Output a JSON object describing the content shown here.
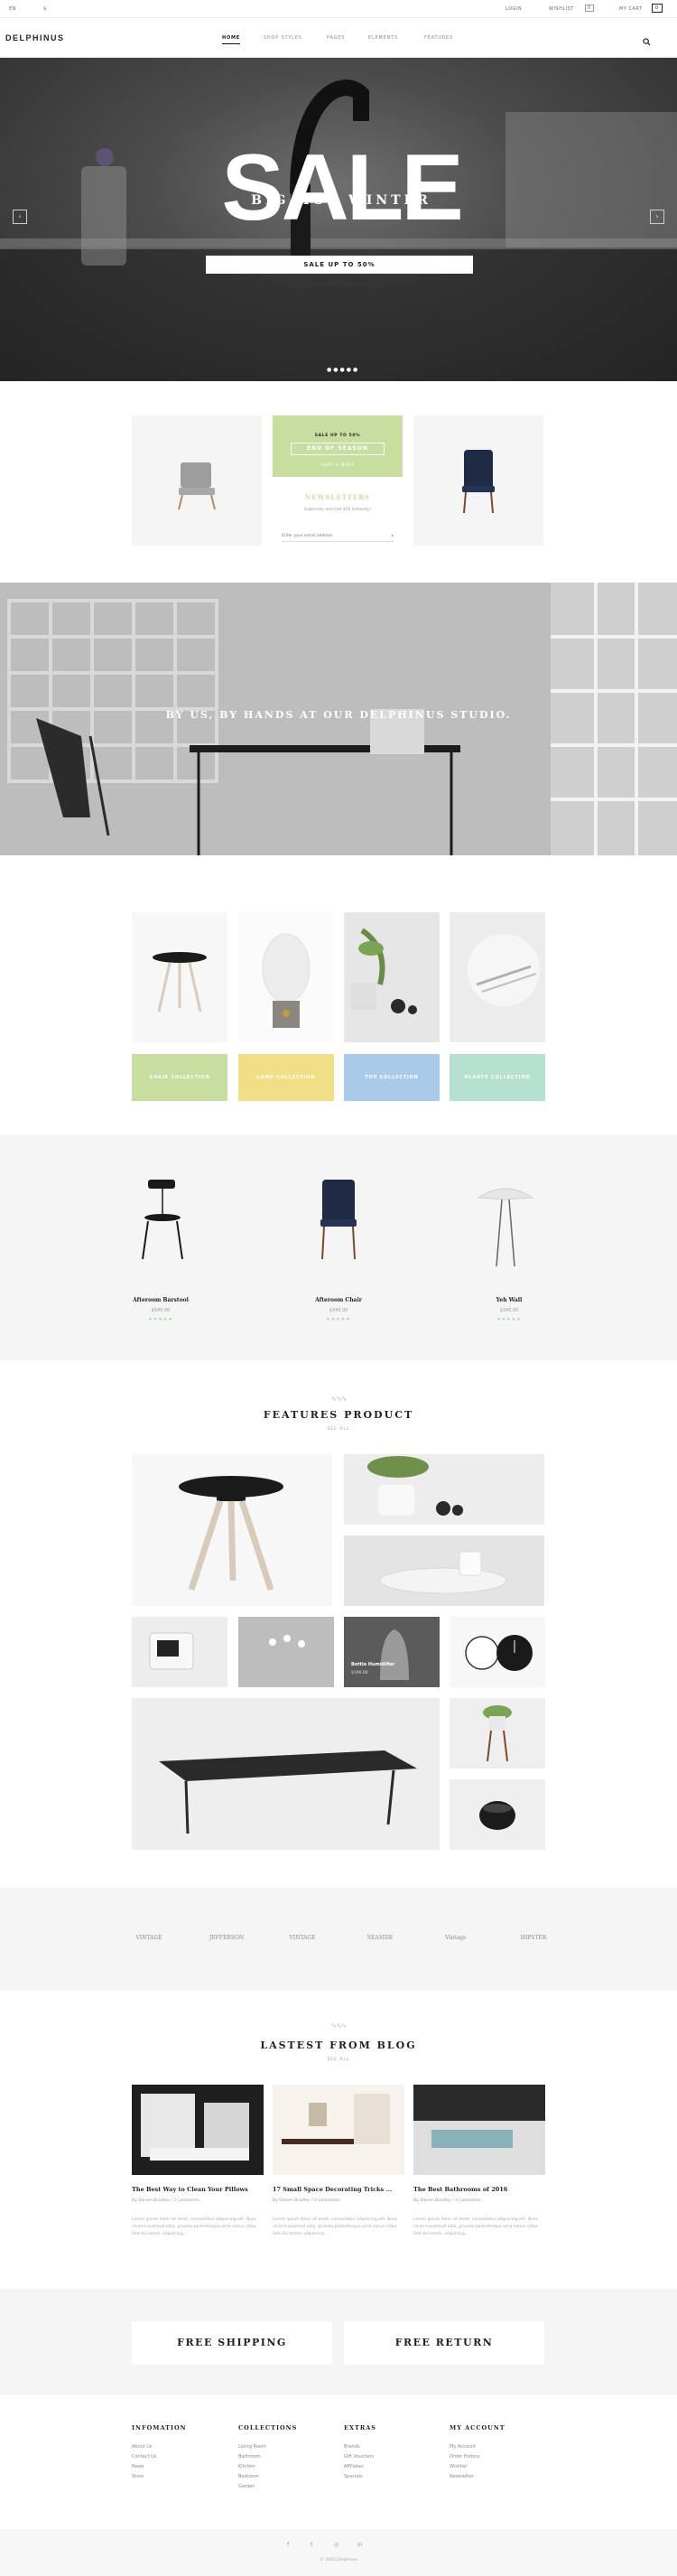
{
  "topbar": {
    "lang": "EN",
    "currency": "$",
    "login": "LOGIN",
    "wishlist": "WISHLIST",
    "wishlist_count": "0",
    "cart": "MY CART",
    "cart_count": "0"
  },
  "header": {
    "logo": "DELPHINUS",
    "nav": [
      "HOME",
      "SHOP STYLES",
      "PAGES",
      "ELEMENTS",
      "FEATURES"
    ]
  },
  "hero": {
    "title": "SALE",
    "subtitle": "BIG HOT WINTER",
    "bar_text": "SALE UP TO 50%",
    "prev_icon": "chevron-left-icon",
    "next_icon": "chevron-right-icon"
  },
  "promo": {
    "small_label": "SALE UP TO 50%",
    "button": "END OF SEASON",
    "link": "SHOP & MORE",
    "newsletter_title": "NEWSLETTERS",
    "newsletter_sub": "Subscribe and Get $50 Instantly!",
    "email_placeholder": "Enter your email address"
  },
  "studio": {
    "text": "BY US, BY HANDS AT OUR DELPHINUS STUDIO."
  },
  "collections": [
    {
      "label": "CHAIR COLLECTION",
      "color": "#c8dea0"
    },
    {
      "label": "LAMP COLLECTION",
      "color": "#f1df86"
    },
    {
      "label": "TOP COLLECTION",
      "color": "#a9cbe9"
    },
    {
      "label": "PLANTS COLLECTION",
      "color": "#b6e0cf"
    }
  ],
  "products": [
    {
      "name": "Afteroom Barstool",
      "price": "$545.00",
      "stars": "★★★★★"
    },
    {
      "name": "Afteroom Chair",
      "price": "$345.00",
      "stars": "★★★★★"
    },
    {
      "name": "Yeh Wall",
      "price": "$345.00",
      "stars": "★★★★★"
    }
  ],
  "features": {
    "title": "FEATURES PRODUCT",
    "sub": "SEE ALL",
    "overlay_label": "Bottle Humidifier",
    "overlay_price": "$199.00"
  },
  "brands": [
    "VINTAGE",
    "JEFFERSON",
    "VINTAGE",
    "SEASIDE",
    "Vintage",
    "HIPSTER"
  ],
  "blog": {
    "title": "LASTEST FROM BLOG",
    "sub": "SEE ALL",
    "posts": [
      {
        "title": "The Best Way to Clean Your Pillows",
        "meta": "By Steven Bradley / 3 Comments",
        "text": "Lorem ipsum dolor sit amet, consectetur adipiscing elit. Nunc viverra euismod odio, gravida pellentesque urna varius vitae. Sed dui lorem, adipiscing..."
      },
      {
        "title": "17 Small Space Decorating Tricks ...",
        "meta": "By Steven Bradley / 3 Comments",
        "text": "Lorem ipsum dolor sit amet, consectetur adipiscing elit. Nunc viverra euismod odio, gravida pellentesque urna varius vitae. Sed dui lorem, adipiscing..."
      },
      {
        "title": "The Best Bathrooms of 2016",
        "meta": "By Steven Bradley / 3 Comments",
        "text": "Lorem ipsum dolor sit amet, consectetur adipiscing elit. Nunc viverra euismod odio, gravida pellentesque urna varius vitae. Sed dui lorem, adipiscing..."
      }
    ]
  },
  "shipping": {
    "left": "FREE SHIPPING",
    "right": "FREE RETURN"
  },
  "footer": {
    "columns": [
      {
        "title": "INFOMATION",
        "links": [
          "About Us",
          "Contact Us",
          "News",
          "Store"
        ]
      },
      {
        "title": "COLLECTIONS",
        "links": [
          "Living Room",
          "Bathroom",
          "Kitchen",
          "Bedroom",
          "Garden"
        ]
      },
      {
        "title": "EXTRAS",
        "links": [
          "Brands",
          "Gift Vouchers",
          "Affiliates",
          "Specials"
        ]
      },
      {
        "title": "MY ACCOUNT",
        "links": [
          "My Account",
          "Order History",
          "Wishlist",
          "Newsletter"
        ]
      }
    ],
    "social": [
      "f",
      "t",
      "◎",
      "in"
    ],
    "copyright": "© 2016 Delphinus"
  }
}
